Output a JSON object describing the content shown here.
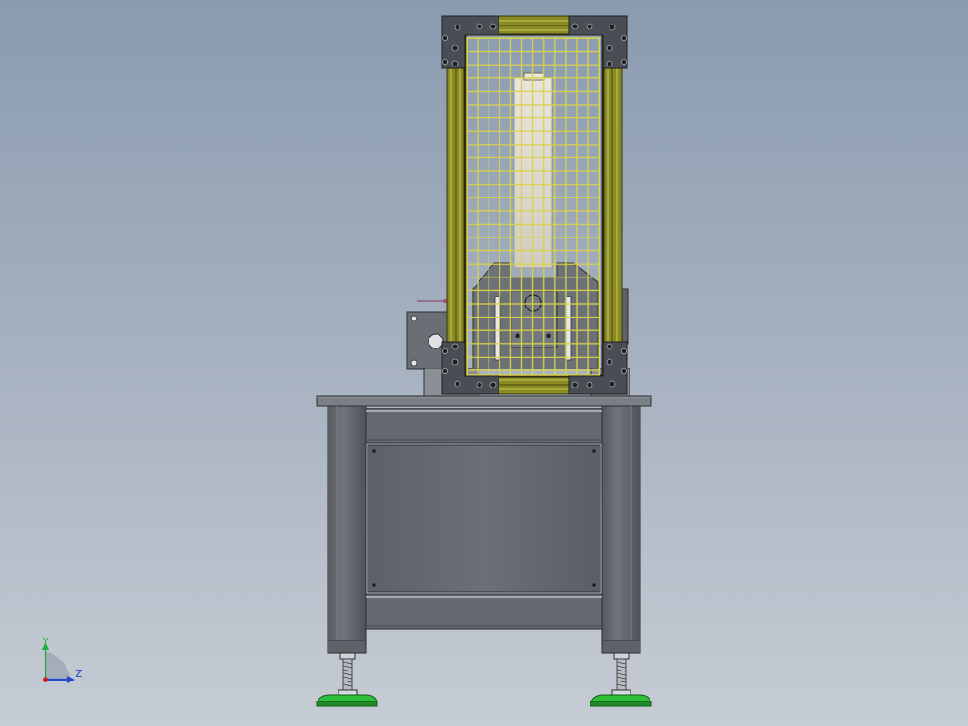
{
  "triad": {
    "y_label": "Y",
    "z_label": "Z",
    "y_color": "#1fae3a",
    "z_color": "#2446c8",
    "x_color": "#d02020"
  },
  "colors": {
    "background_top": "#8a9bb0",
    "background_bottom": "#c6ccd4",
    "guard_frame": "#8a8a1e",
    "mesh": "#d8d44a",
    "steel": "#6d7278",
    "leveling_pad": "#2dbf3a"
  }
}
